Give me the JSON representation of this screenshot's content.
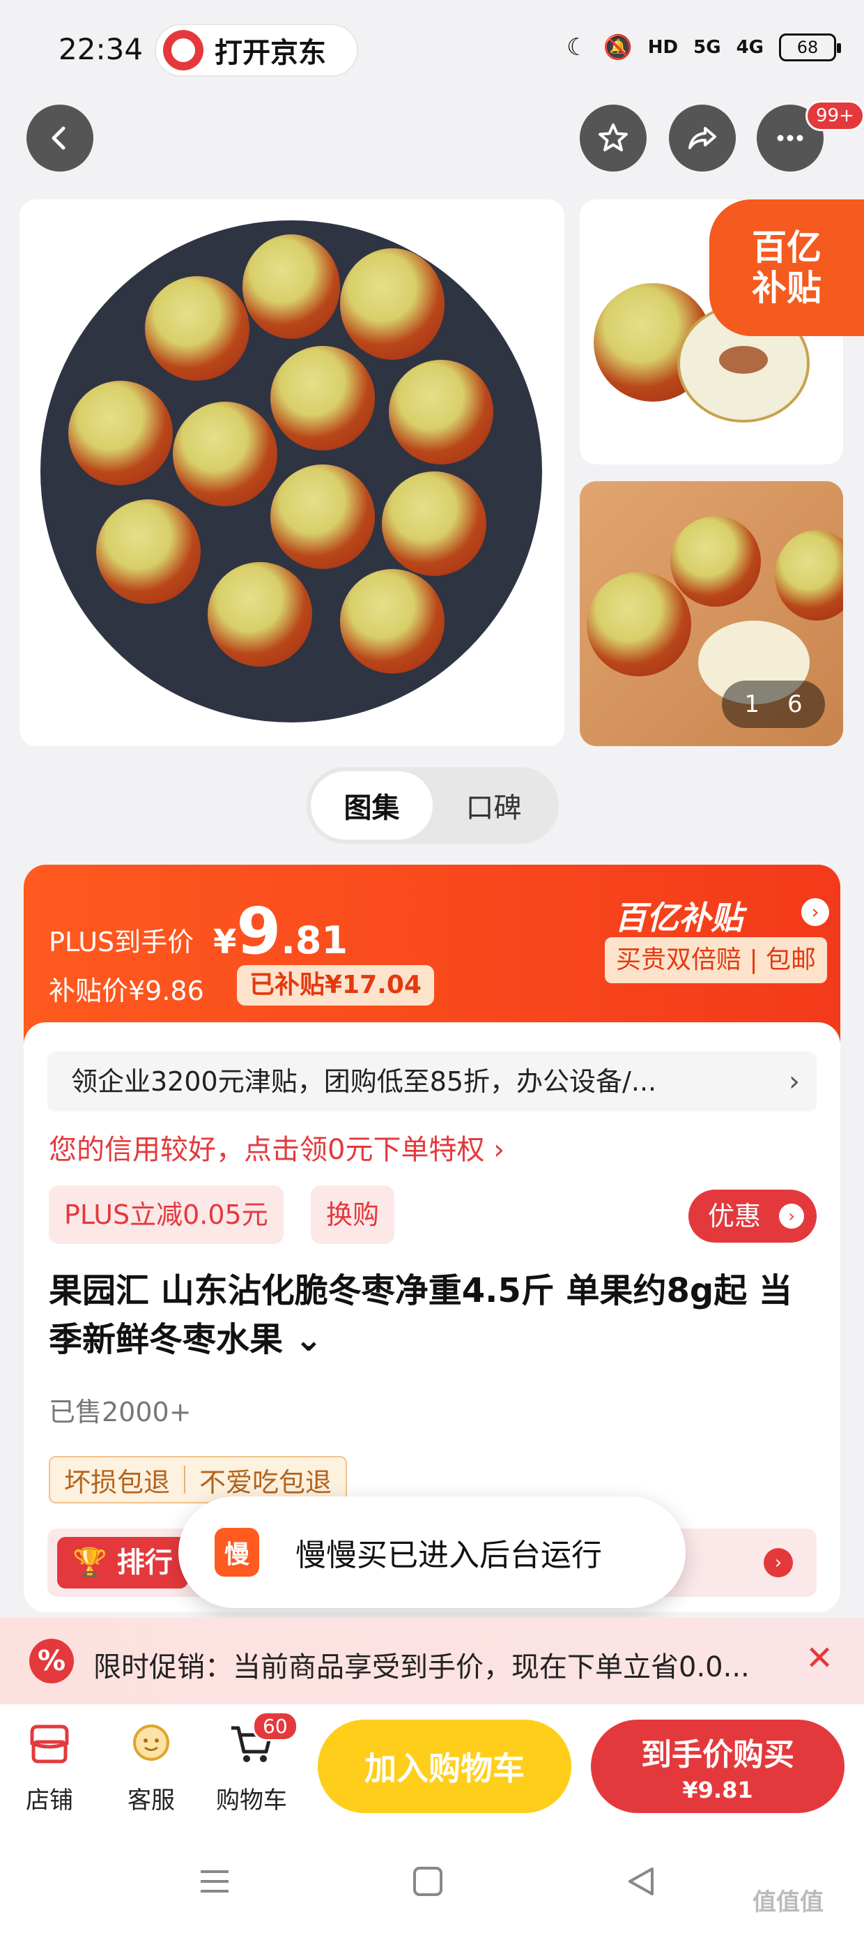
{
  "status_bar": {
    "time": "22:34",
    "open_app_label": "打开京东",
    "hd_label": "HD",
    "net1": "5G",
    "net2": "4G",
    "battery": "68"
  },
  "nav": {
    "more_badge": "99+"
  },
  "gallery": {
    "tag_line1": "百亿",
    "tag_line2": "补贴",
    "page_current": "1",
    "page_total": "6"
  },
  "tabs": [
    "图集",
    "口碑"
  ],
  "price": {
    "plus_label": "PLUS到手价",
    "currency": "¥",
    "int": "9",
    "dec": ".81",
    "subsidy_price": "补贴价¥9.86",
    "subsidy_saved": "已补贴¥17.04",
    "yi_label": "百亿补贴",
    "guarantee": "买贵双倍赔 | 包邮"
  },
  "info": {
    "enterprise_promo": "领企业3200元津贴，团购低至85折，办公设备/...",
    "credit_text": "您的信用较好，点击领0元下单特权 ›",
    "plus_discount": "PLUS立减0.05元",
    "swap_label": "换购",
    "coupon_label": "优惠",
    "title": "果园汇 山东沾化脆冬枣净重4.5斤 单果约8g起 当季新鲜冬枣水果 ⌄",
    "sold": "已售2000+",
    "guarantee_tags": [
      "坏损包退",
      "不爱吃包退"
    ],
    "rank_label": "排行"
  },
  "toast": {
    "app_icon_char": "慢",
    "message": "慢慢买已进入后台运行"
  },
  "promo_strip": {
    "badge": "%",
    "text": "限时促销：当前商品享受到手价，现在下单立省0.0...",
    "close": "✕"
  },
  "bottom_bar": {
    "store": "店铺",
    "service": "客服",
    "cart": "购物车",
    "cart_count": "60",
    "add_to_cart": "加入购物车",
    "buy_line1": "到手价购买",
    "buy_line2": "¥9.81"
  },
  "watermark": "值值值",
  "colors": {
    "jd_red": "#e4393c",
    "subsidy_orange": "#ff5a1f",
    "cart_yellow": "#ffce1a"
  }
}
